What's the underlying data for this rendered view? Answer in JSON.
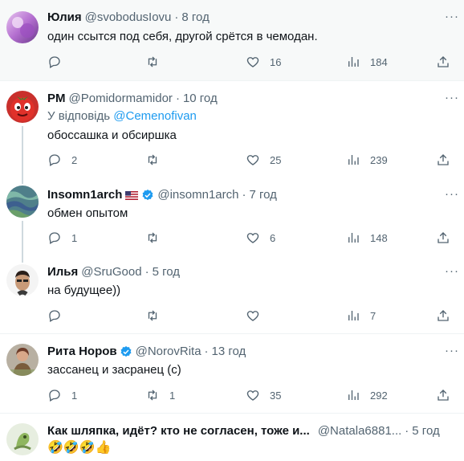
{
  "tweets": [
    {
      "name": "Юлия",
      "handle": "@svobodusIovu",
      "time": "8 год",
      "text": "один ссытся под себя, другой срётся в чемодан.",
      "reply_count": "",
      "retweet_count": "",
      "like_count": "16",
      "view_count": "184"
    },
    {
      "name": "PM",
      "handle": "@Pomidormamidor",
      "time": "10 год",
      "reply_prefix": "У відповідь",
      "reply_to": "@Cemenofivan",
      "text": "обоссашка и обсиршка",
      "reply_count": "2",
      "retweet_count": "",
      "like_count": "25",
      "view_count": "239"
    },
    {
      "name": "Insomn1arch",
      "handle": "@insomn1arch",
      "time": "7 год",
      "text": "обмен опытом",
      "reply_count": "1",
      "retweet_count": "",
      "like_count": "6",
      "view_count": "148"
    },
    {
      "name": "Илья",
      "handle": "@SruGood",
      "time": "5 год",
      "text": "на будущее))",
      "reply_count": "",
      "retweet_count": "",
      "like_count": "",
      "view_count": "7"
    },
    {
      "name": "Рита Норов",
      "handle": "@NorovRita",
      "time": "13 год",
      "text": "зассанец и засранец (с)",
      "reply_count": "1",
      "retweet_count": "1",
      "like_count": "35",
      "view_count": "292"
    },
    {
      "name": "Как шляпка, идёт? кто не согласен, тоже и...",
      "handle": "@Natala6881...",
      "time": "5 год",
      "text": "🤣🤣🤣👍"
    }
  ],
  "more_label": "···",
  "colors": {
    "accent": "#1d9bf0",
    "secondary_text": "#536471",
    "highlight_bg": "#f7f9f9"
  }
}
